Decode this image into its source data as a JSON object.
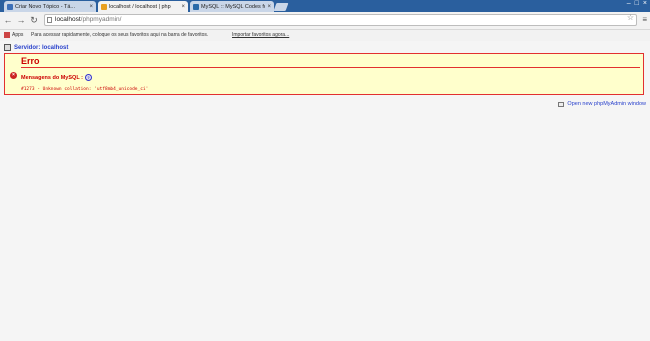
{
  "browser": {
    "tabs": [
      {
        "title": "Criar Novo Tópico - Tá...",
        "icon_color": "#3b6fb8",
        "active": false
      },
      {
        "title": "localhost / localhost | php",
        "icon_color": "#e8a020",
        "active": true
      },
      {
        "title": "MySQL :: MySQL Codes fo",
        "icon_color": "#2a6aa8",
        "active": false
      }
    ],
    "url_host": "localhost",
    "url_path": "/phpmyadmin/",
    "bookmarks": {
      "apps_label": "Apps",
      "prompt": "Para acessar rapidamente, coloque os seus favoritos aqui na barra de favoritos.",
      "import_link": "Importar favoritos agora..."
    }
  },
  "page": {
    "server_label": "Servidor: localhost",
    "error": {
      "title": "Erro",
      "mysql_label": "Mensagens do MySQL :",
      "code": "#1273 - Unknown collation: 'utf8mb4_unicode_ci'"
    },
    "new_window_link": "Open new phpMyAdmin window"
  },
  "colors": {
    "error_border": "#e23030",
    "error_bg": "#ffffcc",
    "link": "#2a42cc",
    "tab_bar": "#2a5f9e"
  }
}
